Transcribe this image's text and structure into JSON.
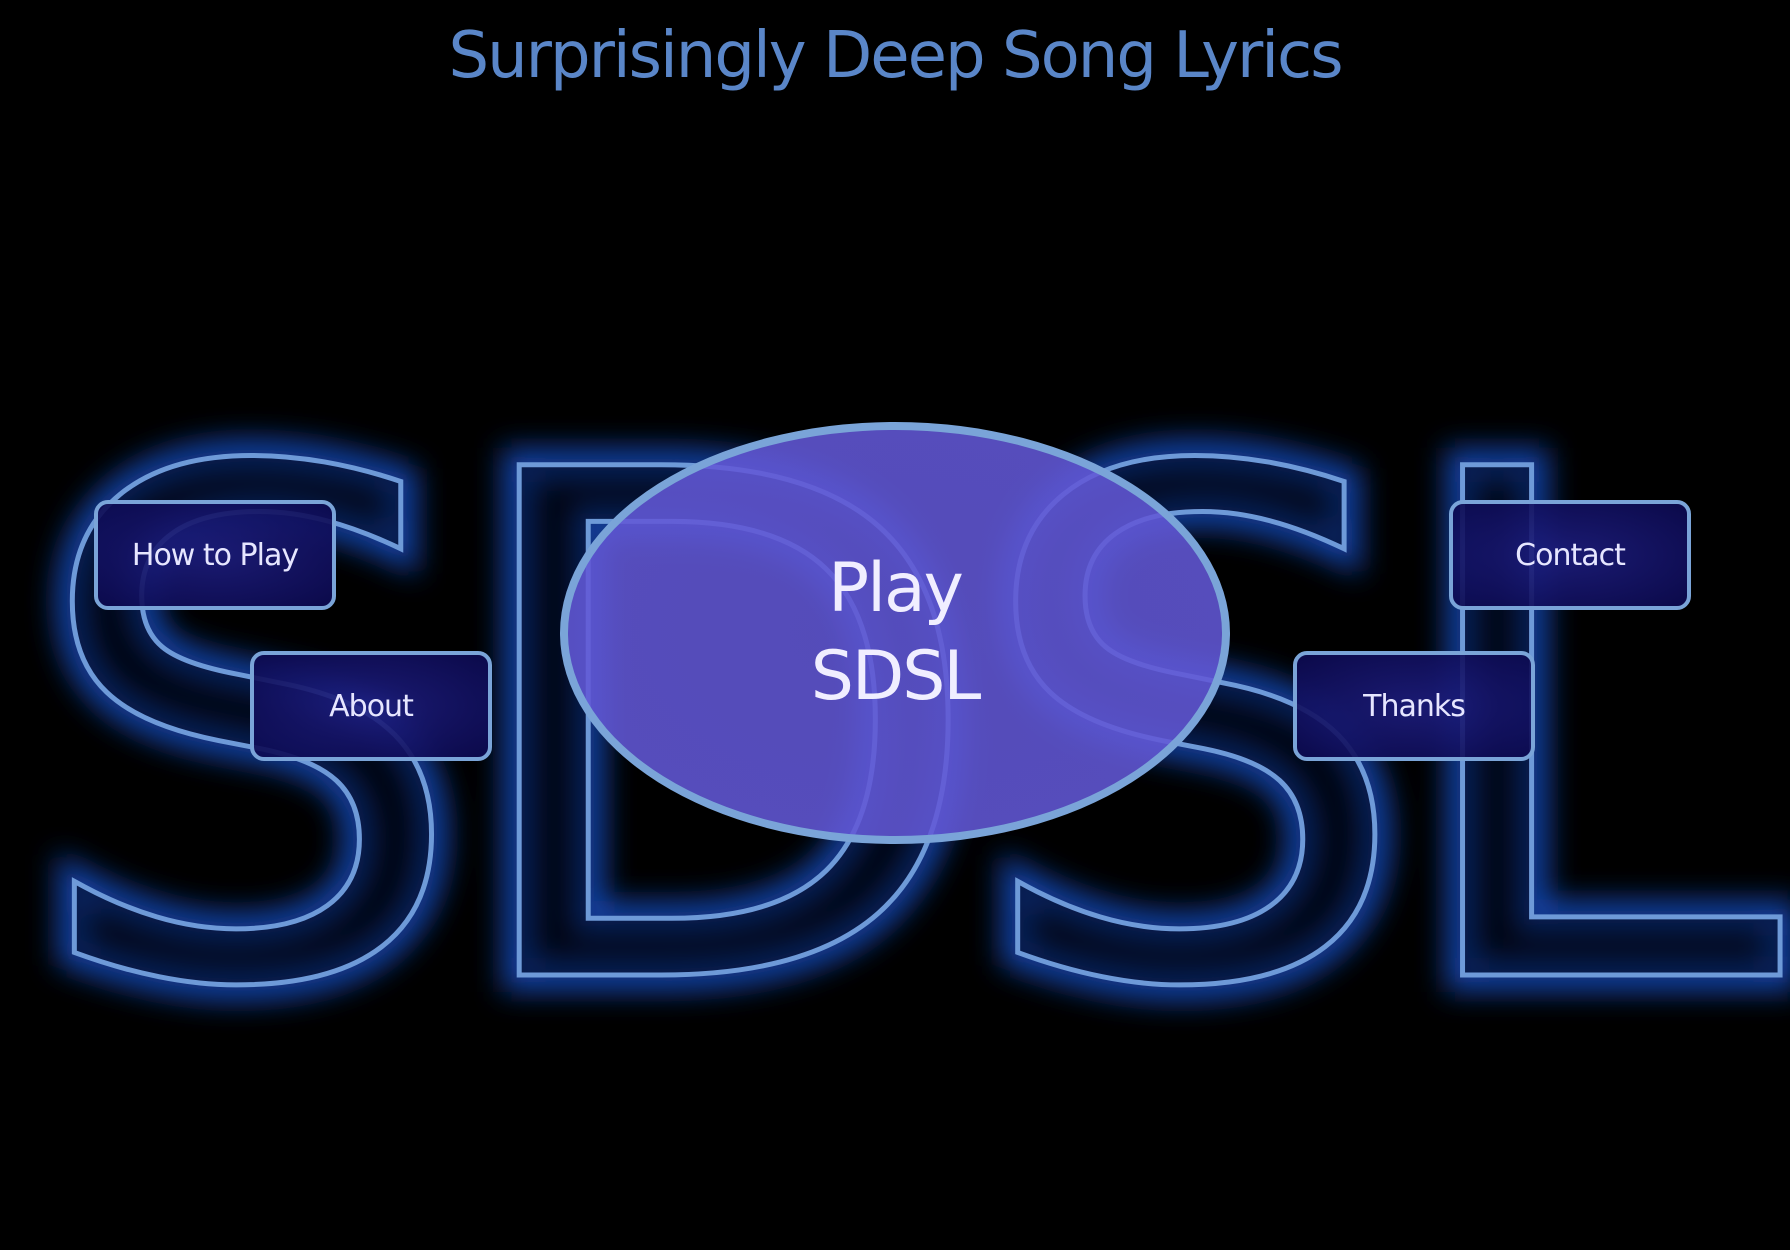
{
  "page": {
    "title": "Surprisingly Deep Song Lyrics"
  },
  "backdrop": {
    "logo_text": "SDSL",
    "glow_color": "#2060e0",
    "stroke_color": "#6e9ad8"
  },
  "menu": {
    "play": {
      "line1": "Play",
      "line2": "SDSL"
    },
    "how_to_play": "How to Play",
    "about": "About",
    "contact": "Contact",
    "thanks": "Thanks"
  },
  "colors": {
    "background": "#000000",
    "title": "#5a86c8",
    "button_fill": "#12106a",
    "button_border": "#7aa4d8",
    "play_fill": "#5e54d2"
  }
}
